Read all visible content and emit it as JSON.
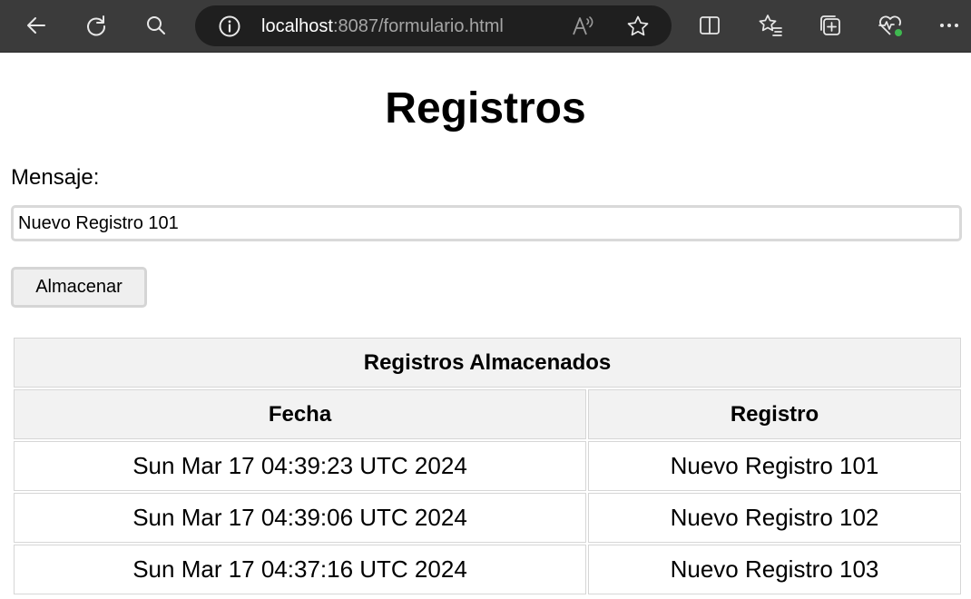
{
  "browser": {
    "address": {
      "host": "localhost",
      "path": ":8087/formulario.html"
    },
    "icons": {
      "back": "back-arrow-icon",
      "refresh": "refresh-icon",
      "search": "search-icon",
      "site_info": "info-icon",
      "read_aloud": "read-aloud-icon",
      "favorite": "star-icon",
      "split_screen": "split-screen-icon",
      "favorites": "favorites-list-icon",
      "collections": "collections-icon",
      "browser_essentials": "heartbeat-icon",
      "more": "more-dots-icon"
    }
  },
  "page": {
    "title": "Registros",
    "form": {
      "message_label": "Mensaje:",
      "message_value": "Nuevo Registro 101",
      "submit_label": "Almacenar"
    },
    "table": {
      "caption": "Registros Almacenados",
      "columns": [
        "Fecha",
        "Registro"
      ],
      "rows": [
        [
          "Sun Mar 17 04:39:23 UTC 2024",
          "Nuevo Registro 101"
        ],
        [
          "Sun Mar 17 04:39:06 UTC 2024",
          "Nuevo Registro 102"
        ],
        [
          "Sun Mar 17 04:37:16 UTC 2024",
          "Nuevo Registro 103"
        ]
      ]
    }
  }
}
